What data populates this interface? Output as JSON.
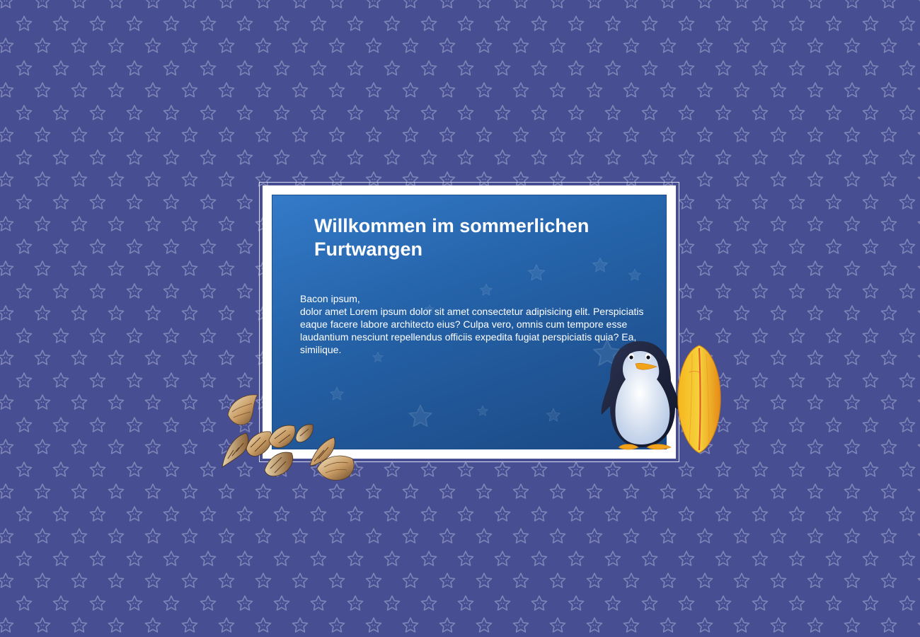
{
  "page": {
    "title": "Willkommen im sommerlichen Furtwangen",
    "greeting": "Bacon ipsum,",
    "paragraph": "dolor amet Lorem ipsum dolor sit amet consectetur adipisicing elit. Perspiciatis eaque facere labore architecto eius? Culpa vero, omnis cum tempore esse laudantium nesciunt repellendus officiis expedita fugiat perspiciatis quia? Ea, similique."
  },
  "decorations": {
    "background_pattern_icon": "star-outline-icon",
    "shells_icon": "seashells-illustration",
    "penguin_icon": "penguin-illustration",
    "surfboard_icon": "surfboard-illustration"
  },
  "colors": {
    "background": "#474e92",
    "star_pattern": "#7f85b6",
    "card_blue_light": "#347bc9",
    "card_blue_dark": "#1b4883",
    "text": "#ffffff"
  }
}
